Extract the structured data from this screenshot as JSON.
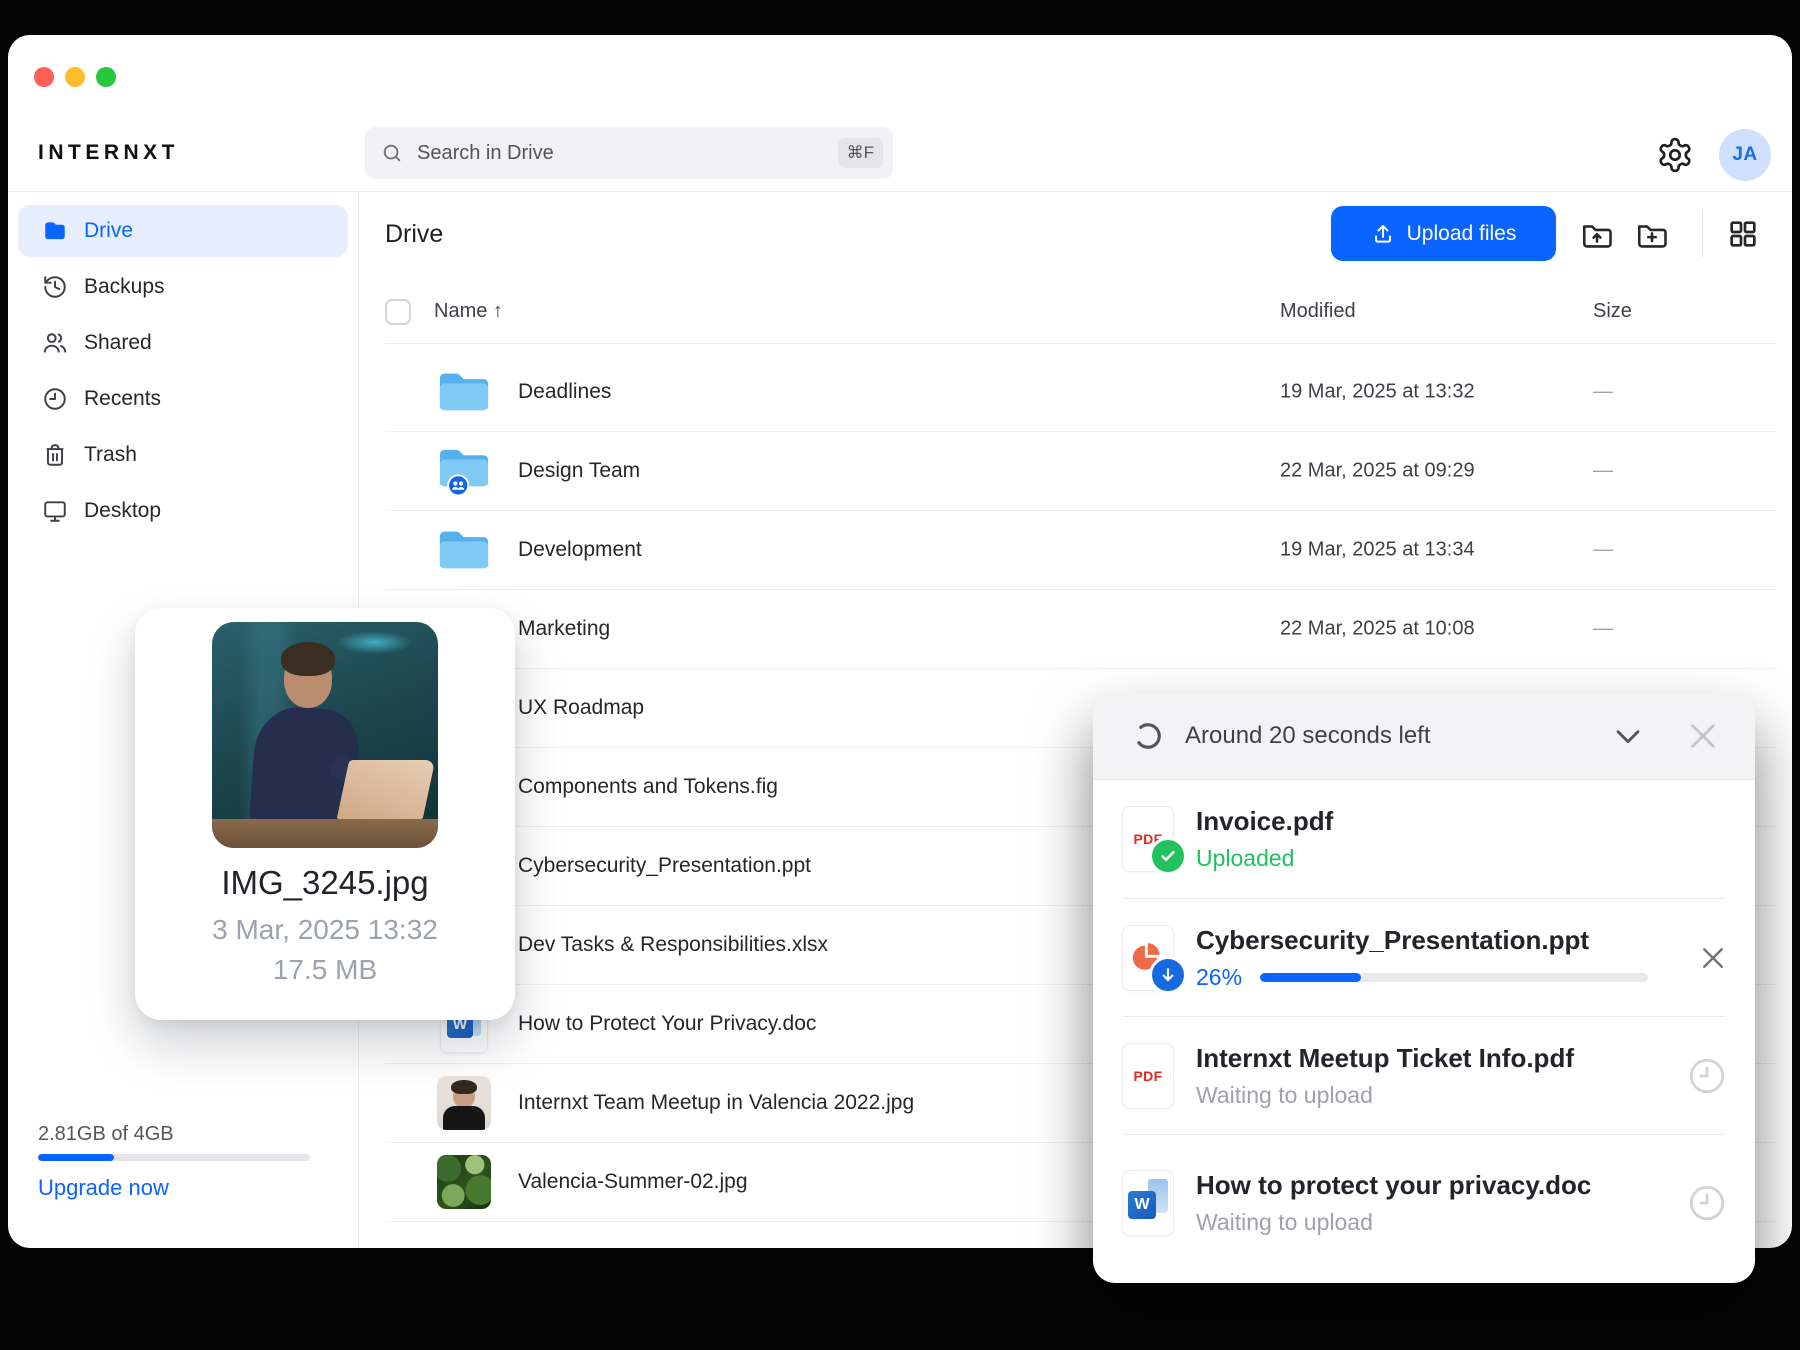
{
  "window": {
    "traffic_light_colors": [
      "#ff5f57",
      "#febc2e",
      "#28c740"
    ]
  },
  "brand": {
    "logo_text": "INTERNXT"
  },
  "topbar": {
    "search_placeholder": "Search in Drive",
    "search_shortcut": "⌘F",
    "avatar_initials": "JA"
  },
  "sidebar": {
    "items": [
      {
        "label": "Drive",
        "icon": "folder-icon",
        "active": true
      },
      {
        "label": "Backups",
        "icon": "history-icon",
        "active": false
      },
      {
        "label": "Shared",
        "icon": "people-icon",
        "active": false
      },
      {
        "label": "Recents",
        "icon": "clock-icon",
        "active": false
      },
      {
        "label": "Trash",
        "icon": "trash-icon",
        "active": false
      },
      {
        "label": "Desktop",
        "icon": "desktop-icon",
        "active": false
      }
    ],
    "storage": {
      "usage_text": "2.81GB of 4GB",
      "bar_fill_percent": 28,
      "upgrade_label": "Upgrade now"
    }
  },
  "main": {
    "page_title": "Drive",
    "toolbar": {
      "upload_button_label": "Upload files"
    },
    "table": {
      "header": {
        "name": "Name",
        "sort_arrow": "↑",
        "modified": "Modified",
        "size": "Size"
      },
      "rows": [
        {
          "name": "Deadlines",
          "modified": "19 Mar, 2025 at 13:32",
          "size": "—"
        },
        {
          "name": "Design Team",
          "modified": "22 Mar, 2025 at 09:29",
          "size": "—"
        },
        {
          "name": "Development",
          "modified": "19 Mar, 2025 at 13:34",
          "size": "—"
        },
        {
          "name": "Marketing",
          "modified": "22 Mar, 2025 at 10:08",
          "size": "—"
        },
        {
          "name": "UX Roadmap",
          "modified": "",
          "size": ""
        },
        {
          "name": "Components and Tokens.fig",
          "modified": "",
          "size": ""
        },
        {
          "name": "Cybersecurity_Presentation.ppt",
          "modified": "",
          "size": ""
        },
        {
          "name": "Dev Tasks & Responsibilities.xlsx",
          "modified": "",
          "size": ""
        },
        {
          "name": "How to Protect Your Privacy.doc",
          "modified": "",
          "size": ""
        },
        {
          "name": "Internxt Team Meetup in Valencia 2022.jpg",
          "modified": "",
          "size": ""
        },
        {
          "name": "Valencia-Summer-02.jpg",
          "modified": "",
          "size": ""
        }
      ]
    }
  },
  "preview_card": {
    "filename": "IMG_3245.jpg",
    "modified": "3 Mar, 2025 13:32",
    "filesize": "17.5 MB"
  },
  "upload_toast": {
    "time_remaining": "Around 20 seconds left",
    "items": [
      {
        "filename": "Invoice.pdf",
        "status": "Uploaded",
        "file_type": "pdf"
      },
      {
        "filename": "Cybersecurity_Presentation.ppt",
        "status": "26%",
        "progress_percent": 26,
        "file_type": "ppt"
      },
      {
        "filename": "Internxt Meetup Ticket Info.pdf",
        "status": "Waiting to upload",
        "file_type": "pdf"
      },
      {
        "filename": "How to protect your privacy.doc",
        "status": "Waiting to upload",
        "file_type": "doc"
      }
    ]
  },
  "colors": {
    "accent_blue": "#0a64ff",
    "success_green": "#21c25e",
    "pdf_red": "#e02b20",
    "ppt_orange": "#ed6c47",
    "word_blue": "#185abd"
  }
}
